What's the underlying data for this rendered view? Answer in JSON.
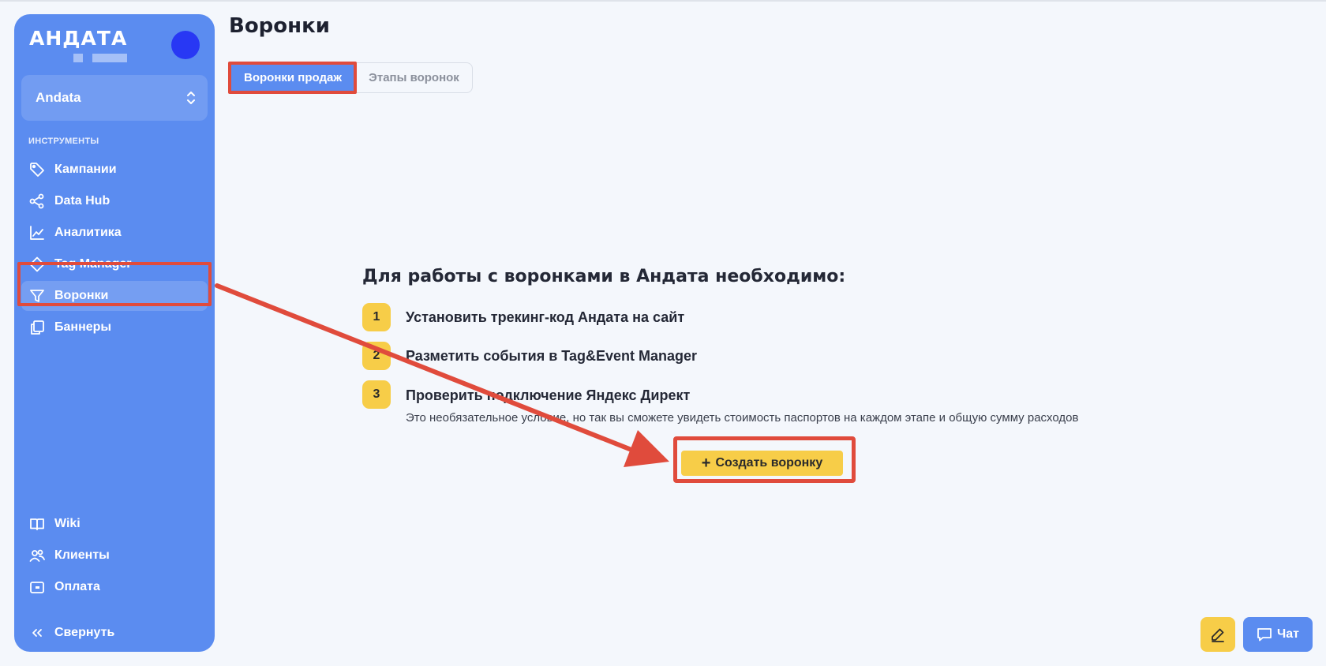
{
  "sidebar": {
    "logo": "АНДАТА",
    "account": "Andata",
    "section_label": "ИНСТРУМЕНТЫ",
    "items": [
      {
        "label": "Кампании",
        "icon": "tag-icon"
      },
      {
        "label": "Data Hub",
        "icon": "share-nodes-icon"
      },
      {
        "label": "Аналитика",
        "icon": "line-chart-icon"
      },
      {
        "label": "Tag Manager",
        "icon": "diamond-icon"
      },
      {
        "label": "Воронки",
        "icon": "funnel-icon",
        "active": true
      },
      {
        "label": "Баннеры",
        "icon": "banners-icon"
      }
    ],
    "bottom_items": [
      {
        "label": "Wiki",
        "icon": "book-icon"
      },
      {
        "label": "Клиенты",
        "icon": "users-icon"
      },
      {
        "label": "Оплата",
        "icon": "payment-icon"
      }
    ],
    "collapse_label": "Свернуть"
  },
  "page": {
    "title": "Воронки",
    "tabs": [
      {
        "label": "Воронки продаж",
        "active": true
      },
      {
        "label": "Этапы воронок",
        "active": false
      }
    ]
  },
  "requirements": {
    "title": "Для работы с воронками в Андата необходимо:",
    "steps": [
      {
        "num": "1",
        "text": "Установить трекинг-код Андата на сайт"
      },
      {
        "num": "2",
        "text": "Разметить события в Tag&Event Manager"
      },
      {
        "num": "3",
        "text": "Проверить подключение Яндекс Директ",
        "note": "Это необязательное условие, но так вы сможете увидеть стоимость паспортов на каждом этапе и общую сумму расходов"
      }
    ],
    "create_button": "Создать воронку"
  },
  "floating": {
    "chat_label": "Чат"
  },
  "colors": {
    "sidebar": "#5b8cf0",
    "accent_yellow": "#f7cd48",
    "annotation_red": "#e04b3c",
    "avatar": "#2838f4"
  }
}
